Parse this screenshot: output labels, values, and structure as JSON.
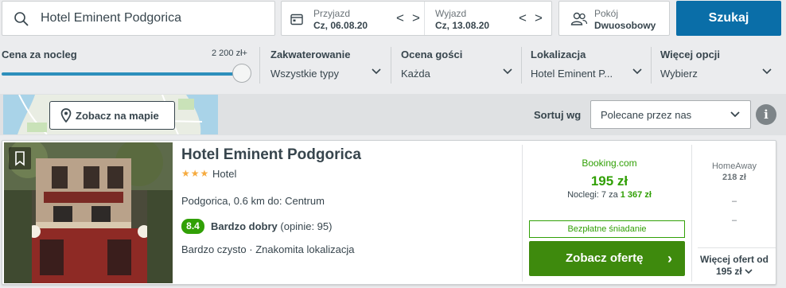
{
  "search": {
    "query": "Hotel Eminent Podgorica"
  },
  "dates": {
    "checkin_label": "Przyjazd",
    "checkin_value": "Cz, 06.08.20",
    "checkout_label": "Wyjazd",
    "checkout_value": "Cz, 13.08.20",
    "prev_arrow": "<",
    "next_arrow": ">"
  },
  "rooms": {
    "label": "Pokój",
    "value": "Dwuosobowy"
  },
  "search_button": "Szukaj",
  "filters": {
    "price": {
      "label": "Cena za nocleg",
      "max": "2 200 zł+",
      "slider_level": 1.0
    },
    "accommodation": {
      "label": "Zakwaterowanie",
      "value": "Wszystkie typy"
    },
    "rating": {
      "label": "Ocena gości",
      "value": "Każda"
    },
    "location": {
      "label": "Lokalizacja",
      "value": "Hotel Eminent P..."
    },
    "more": {
      "label": "Więcej opcji",
      "value": "Wybierz"
    }
  },
  "map_button": "Zobacz na mapie",
  "sort": {
    "label": "Sortuj wg",
    "value": "Polecane przez nas"
  },
  "info_icon_glyph": "i",
  "hotel": {
    "name": "Hotel Eminent Podgorica",
    "stars": "★★★",
    "star_count": 3,
    "type": "Hotel",
    "location": "Podgorica, 0.6 km do: Centrum",
    "rating_score": "8.4",
    "rating_word": "Bardzo dobry",
    "rating_reviews": "(opinie: 95)",
    "features": "Bardzo czysto · Znakomita lokalizacja"
  },
  "deal": {
    "provider": "Booking.com",
    "price": "195 zł",
    "nights_prefix": "Noclegi: 7 za",
    "nights_total": "1 367 zł",
    "perk": "Bezpłatne śniadanie",
    "cta": "Zobacz ofertę",
    "cta_chevron": "›"
  },
  "alt_deal": {
    "provider": "HomeAway",
    "price": "218 zł",
    "dash1": "–",
    "dash2": "–",
    "more_line1": "Więcej ofert od",
    "more_line2": "195 zł"
  },
  "colors": {
    "primary": "#0a6ea8",
    "deal_green": "#31a006",
    "cta_green": "#3e8a0d",
    "star": "#f6ab3f"
  }
}
